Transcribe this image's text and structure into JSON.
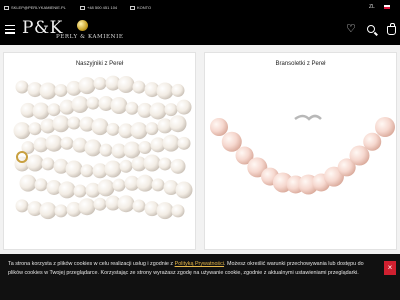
{
  "topbar": {
    "email": "SKLEP@PERLYKAMIENIE.PL",
    "phone": "+48 500 451 104",
    "account": "KONTO",
    "language": "ZL",
    "flag_colors": [
      "#ffffff",
      "#dc143c"
    ]
  },
  "header": {
    "logo_main": "P&K",
    "logo_sub": "PERLY & KAMIENIE",
    "icons": [
      "menu-icon",
      "heart-icon",
      "search-icon",
      "cart-icon"
    ]
  },
  "categories": [
    {
      "title": "Naszyjniki z Pereł"
    },
    {
      "title": "Bransoletki z Pereł"
    }
  ],
  "cookie": {
    "text_before": "Ta strona korzysta z plików cookies w celu realizacji usług i zgodnie z ",
    "link": "Polityką Prywatności",
    "text_after": ". Możesz określić warunki przechowywania lub dostępu do plików cookies w Twojej przeglądarce. Korzystając ze strony wyrażasz zgodę na używanie cookie, zgodnie z aktualnymi ustawieniami przeglądarki.",
    "close_label": "×"
  },
  "colors": {
    "accent": "#e8b84a",
    "close": "#d02030",
    "bg_dark": "#000000"
  }
}
